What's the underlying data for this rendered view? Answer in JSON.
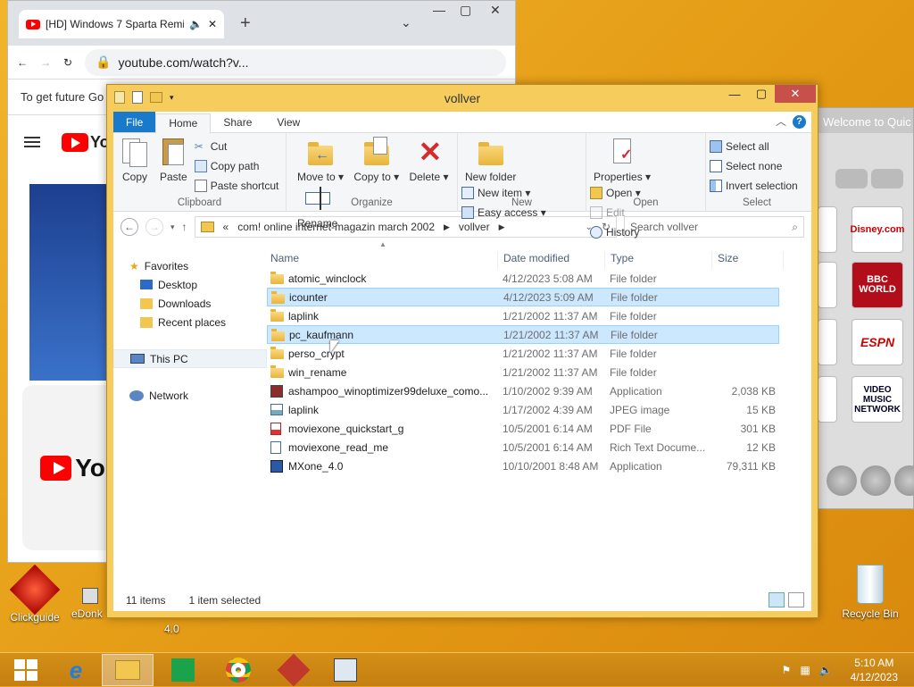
{
  "browser": {
    "tab_title": "[HD] Windows 7 Sparta Remix",
    "url": "youtube.com/watch?v...",
    "banner_text": "To get future Go",
    "yt_short": "Yo",
    "yt_card_text": "You"
  },
  "quick_window": {
    "title": "Welcome to Quic",
    "logos": [
      "Disney.com",
      "BBC WORLD",
      "ESPN",
      "VIDEO MUSIC NETWORK"
    ]
  },
  "explorer": {
    "title": "vollver",
    "tabs": [
      "File",
      "Home",
      "Share",
      "View"
    ],
    "ribbon": {
      "clipboard": {
        "label": "Clipboard",
        "copy": "Copy",
        "paste": "Paste",
        "cut": "Cut",
        "copy_path": "Copy path",
        "paste_shortcut": "Paste shortcut"
      },
      "organize": {
        "label": "Organize",
        "move_to": "Move to ▾",
        "copy_to": "Copy to ▾",
        "delete": "Delete ▾",
        "rename": "Rename"
      },
      "new": {
        "label": "New",
        "new_folder": "New folder",
        "new_item": "New item ▾",
        "easy_access": "Easy access ▾"
      },
      "open": {
        "label": "Open",
        "properties": "Properties ▾",
        "open": "Open ▾",
        "edit": "Edit",
        "history": "History"
      },
      "select": {
        "label": "Select",
        "select_all": "Select all",
        "select_none": "Select none",
        "invert": "Invert selection"
      }
    },
    "breadcrumb": {
      "prefix": "«",
      "parent": "com! online internet-magazin march 2002",
      "current": "vollver"
    },
    "search_placeholder": "Search vollver",
    "nav": {
      "favorites": "Favorites",
      "desktop": "Desktop",
      "downloads": "Downloads",
      "recent": "Recent places",
      "this_pc": "This PC",
      "network": "Network"
    },
    "columns": {
      "name": "Name",
      "date": "Date modified",
      "type": "Type",
      "size": "Size"
    },
    "files": [
      {
        "name": "atomic_winclock",
        "date": "4/12/2023 5:08 AM",
        "type": "File folder",
        "size": "",
        "icon": "folder-icon"
      },
      {
        "name": "icounter",
        "date": "4/12/2023 5:09 AM",
        "type": "File folder",
        "size": "",
        "icon": "folder-icon"
      },
      {
        "name": "laplink",
        "date": "1/21/2002 11:37 AM",
        "type": "File folder",
        "size": "",
        "icon": "folder-icon"
      },
      {
        "name": "pc_kaufmann",
        "date": "1/21/2002 11:37 AM",
        "type": "File folder",
        "size": "",
        "icon": "folder-icon"
      },
      {
        "name": "perso_crypt",
        "date": "1/21/2002 11:37 AM",
        "type": "File folder",
        "size": "",
        "icon": "folder-icon"
      },
      {
        "name": "win_rename",
        "date": "1/21/2002 11:37 AM",
        "type": "File folder",
        "size": "",
        "icon": "folder-icon"
      },
      {
        "name": "ashampoo_winoptimizer99deluxe_como...",
        "date": "1/10/2002 9:39 AM",
        "type": "Application",
        "size": "2,038 KB",
        "icon": "installer-icon"
      },
      {
        "name": "laplink",
        "date": "1/17/2002 4:39 AM",
        "type": "JPEG image",
        "size": "15 KB",
        "icon": "image-icon"
      },
      {
        "name": "moviexone_quickstart_g",
        "date": "10/5/2001 6:14 AM",
        "type": "PDF File",
        "size": "301 KB",
        "icon": "pdf-icon"
      },
      {
        "name": "moviexone_read_me",
        "date": "10/5/2001 6:14 AM",
        "type": "Rich Text Docume...",
        "size": "12 KB",
        "icon": "document-icon"
      },
      {
        "name": "MXone_4.0",
        "date": "10/10/2001 8:48 AM",
        "type": "Application",
        "size": "79,311 KB",
        "icon": "application-icon"
      }
    ],
    "status": {
      "count": "11 items",
      "selected": "1 item selected"
    }
  },
  "desktop_icons": {
    "clickguide": "Clickguide",
    "edonkey": "eDonk",
    "edonkey_sub": "4.0",
    "recycle": "Recycle Bin"
  },
  "taskbar": {
    "time": "5:10 AM",
    "date": "4/12/2023"
  }
}
